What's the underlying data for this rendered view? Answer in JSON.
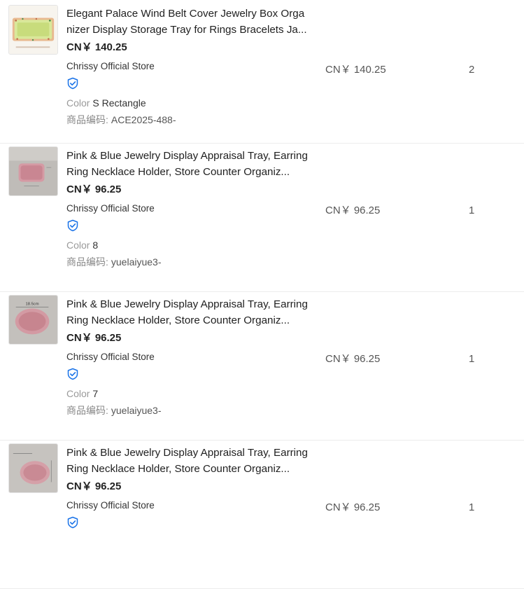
{
  "badge_color": "#1a73e8",
  "items": [
    {
      "title": "Elegant Palace Wind Belt Cover Jewelry Box Organizer Display Storage Tray for Rings Bracelets Ja...",
      "price": "CN￥ 140.25",
      "store": "Chrissy Official Store",
      "sku_key": "Color",
      "sku_value": "S Rectangle",
      "code_label": "商品编码:",
      "code_value": "ACE2025-488-",
      "unit_price": "CN￥ 140.25",
      "quantity": "2",
      "thumb": "jewelry-box"
    },
    {
      "title": "Pink & Blue Jewelry Display Appraisal Tray, Earring Ring Necklace Holder, Store Counter Organiz...",
      "price": "CN￥ 96.25",
      "store": "Chrissy Official Store",
      "sku_key": "Color",
      "sku_value": "8",
      "code_label": "商品编码:",
      "code_value": "yuelaiyue3-",
      "unit_price": "CN￥ 96.25",
      "quantity": "1",
      "thumb": "pink-rect-tray"
    },
    {
      "title": "Pink & Blue Jewelry Display Appraisal Tray, Earring Ring Necklace Holder, Store Counter Organiz...",
      "price": "CN￥ 96.25",
      "store": "Chrissy Official Store",
      "sku_key": "Color",
      "sku_value": "7",
      "code_label": "商品编码:",
      "code_value": "yuelaiyue3-",
      "unit_price": "CN￥ 96.25",
      "quantity": "1",
      "thumb": "pink-oval-tray",
      "thumb_text": "18.5cm"
    },
    {
      "title": "Pink & Blue Jewelry Display Appraisal Tray, Earring Ring Necklace Holder, Store Counter Organiz...",
      "price": "CN￥ 96.25",
      "store": "Chrissy Official Store",
      "unit_price": "CN￥ 96.25",
      "quantity": "1",
      "thumb": "pink-oval-tray-2"
    }
  ]
}
